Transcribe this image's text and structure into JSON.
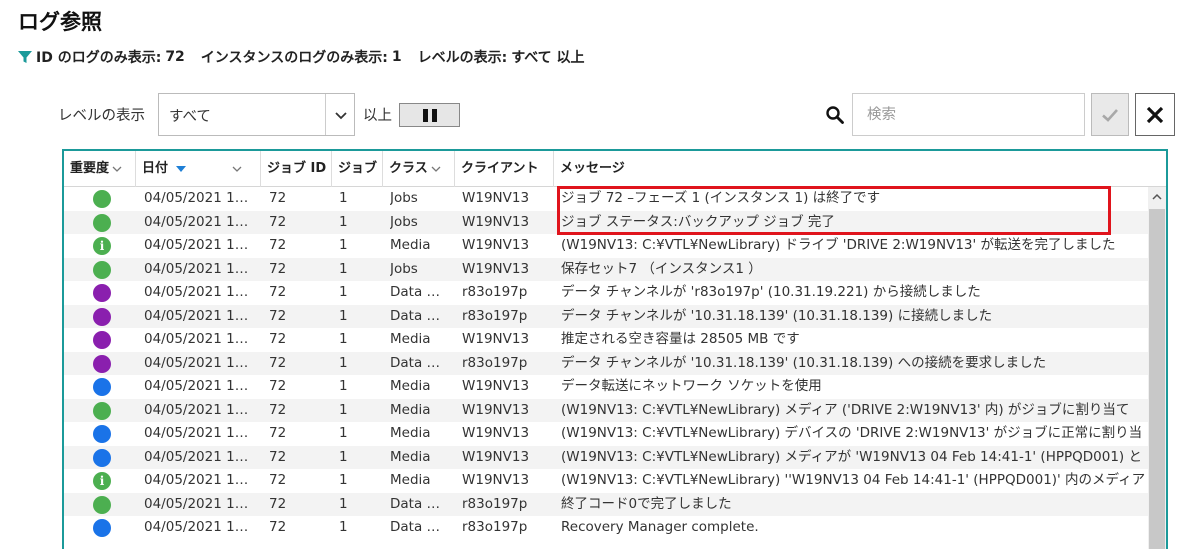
{
  "page": {
    "title": "ログ参照"
  },
  "filter_summary": {
    "id_label": "ID のログのみ表示:",
    "id_value": "72",
    "instance_label": "インスタンスのログのみ表示:",
    "instance_value": "1",
    "level_label": "レベルの表示:",
    "level_value": "すべて 以上"
  },
  "toolbar": {
    "level_label": "レベルの表示",
    "level_selected": "すべて",
    "above_label": "以上",
    "search_placeholder": "検索"
  },
  "table": {
    "columns": {
      "severity": "重要度",
      "date": "日付",
      "job_id": "ジョブ ID",
      "job": "ジョブ",
      "class": "クラス",
      "client": "クライアント",
      "message": "メッセージ"
    },
    "rows": [
      {
        "severity": "success",
        "date": "04/05/2021 1…",
        "job_id": "72",
        "job": "1",
        "class": "Jobs",
        "client": "W19NV13",
        "message": "ジョブ 72 –フェーズ 1 (インスタンス 1) は終了です"
      },
      {
        "severity": "success",
        "date": "04/05/2021 1…",
        "job_id": "72",
        "job": "1",
        "class": "Jobs",
        "client": "W19NV13",
        "message": "ジョブ ステータス:バックアップ ジョブ 完了"
      },
      {
        "severity": "info",
        "date": "04/05/2021 1…",
        "job_id": "72",
        "job": "1",
        "class": "Media",
        "client": "W19NV13",
        "message": "(W19NV13: C:¥VTL¥NewLibrary) ドライブ 'DRIVE 2:W19NV13' が転送を完了しました"
      },
      {
        "severity": "success",
        "date": "04/05/2021 1…",
        "job_id": "72",
        "job": "1",
        "class": "Jobs",
        "client": "W19NV13",
        "message": "保存セット7 （インスタンス1 ）"
      },
      {
        "severity": "purple",
        "date": "04/05/2021 1…",
        "job_id": "72",
        "job": "1",
        "class": "Data …",
        "client": "r83o197p",
        "message": "データ チャンネルが 'r83o197p' (10.31.19.221) から接続しました"
      },
      {
        "severity": "purple",
        "date": "04/05/2021 1…",
        "job_id": "72",
        "job": "1",
        "class": "Data …",
        "client": "r83o197p",
        "message": "データ チャンネルが '10.31.18.139' (10.31.18.139) に接続しました"
      },
      {
        "severity": "purple",
        "date": "04/05/2021 1…",
        "job_id": "72",
        "job": "1",
        "class": "Media",
        "client": "W19NV13",
        "message": "推定される空き容量は 28505 MB です"
      },
      {
        "severity": "purple",
        "date": "04/05/2021 1…",
        "job_id": "72",
        "job": "1",
        "class": "Data …",
        "client": "r83o197p",
        "message": "データ チャンネルが '10.31.18.139' (10.31.18.139) への接続を要求しました"
      },
      {
        "severity": "blue",
        "date": "04/05/2021 1…",
        "job_id": "72",
        "job": "1",
        "class": "Media",
        "client": "W19NV13",
        "message": "データ転送にネットワーク ソケットを使用"
      },
      {
        "severity": "success",
        "date": "04/05/2021 1…",
        "job_id": "72",
        "job": "1",
        "class": "Media",
        "client": "W19NV13",
        "message": "(W19NV13: C:¥VTL¥NewLibrary) メディア ('DRIVE 2:W19NV13' 内) がジョブに割り当て"
      },
      {
        "severity": "blue",
        "date": "04/05/2021 1…",
        "job_id": "72",
        "job": "1",
        "class": "Media",
        "client": "W19NV13",
        "message": "(W19NV13: C:¥VTL¥NewLibrary) デバイスの 'DRIVE 2:W19NV13' がジョブに正常に割り当"
      },
      {
        "severity": "blue",
        "date": "04/05/2021 1…",
        "job_id": "72",
        "job": "1",
        "class": "Media",
        "client": "W19NV13",
        "message": "(W19NV13: C:¥VTL¥NewLibrary) メディアが 'W19NV13 04 Feb 14:41-1' (HPPQD001) と"
      },
      {
        "severity": "info",
        "date": "04/05/2021 1…",
        "job_id": "72",
        "job": "1",
        "class": "Media",
        "client": "W19NV13",
        "message": "(W19NV13: C:¥VTL¥NewLibrary) ''W19NV13 04 Feb 14:41-1' (HPPQD001)' 内のメディア"
      },
      {
        "severity": "success",
        "date": "04/05/2021 1…",
        "job_id": "72",
        "job": "1",
        "class": "Data …",
        "client": "r83o197p",
        "message": "終了コード0で完了しました"
      },
      {
        "severity": "blue",
        "date": "04/05/2021 1…",
        "job_id": "72",
        "job": "1",
        "class": "Data …",
        "client": "r83o197p",
        "message": "Recovery Manager complete."
      }
    ]
  },
  "icons": {
    "filter": "funnel-icon",
    "search": "search-icon",
    "confirm": "checkmark-icon",
    "clear": "close-icon",
    "pause": "pause-icon",
    "info": "i"
  },
  "colors": {
    "accent": "#1b9a9a",
    "sort_arrow": "#1e7fd6",
    "success": "#4caf50",
    "info": "#4caf50",
    "purple": "#8a1fae",
    "blue": "#1a73e8",
    "highlight": "#e0141c"
  }
}
